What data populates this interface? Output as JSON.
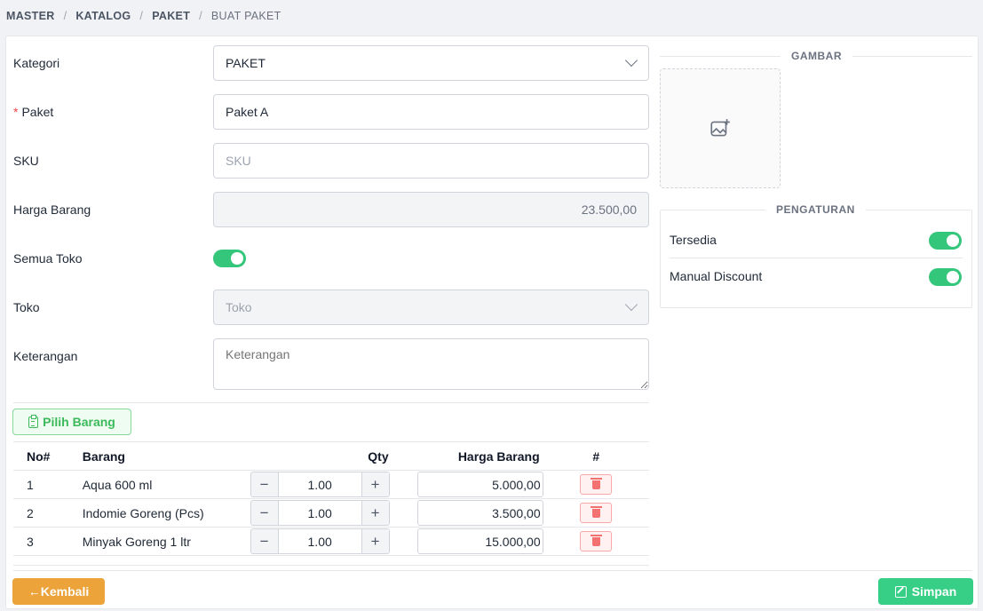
{
  "breadcrumb": [
    "MASTER",
    "KATALOG",
    "PAKET",
    "BUAT PAKET"
  ],
  "form": {
    "kategori": {
      "label": "Kategori",
      "value": "PAKET"
    },
    "paket": {
      "label": "Paket",
      "required_mark": "*",
      "value": "Paket A"
    },
    "sku": {
      "label": "SKU",
      "placeholder": "SKU"
    },
    "harga_barang": {
      "label": "Harga Barang",
      "value": "23.500,00"
    },
    "semua_toko": {
      "label": "Semua Toko",
      "on": true
    },
    "toko": {
      "label": "Toko",
      "placeholder": "Toko"
    },
    "keterangan": {
      "label": "Keterangan",
      "placeholder": "Keterangan"
    }
  },
  "pilih_barang_label": "Pilih Barang",
  "table": {
    "headers": {
      "no": "No#",
      "barang": "Barang",
      "qty": "Qty",
      "harga": "Harga Barang",
      "action": "#"
    },
    "rows": [
      {
        "no": "1",
        "barang": "Aqua 600 ml",
        "qty": "1.00",
        "harga": "5.000,00"
      },
      {
        "no": "2",
        "barang": "Indomie Goreng (Pcs)",
        "qty": "1.00",
        "harga": "3.500,00"
      },
      {
        "no": "3",
        "barang": "Minyak Goreng 1 ltr",
        "qty": "1.00",
        "harga": "15.000,00"
      }
    ]
  },
  "gambar_title": "GAMBAR",
  "pengaturan": {
    "title": "PENGATURAN",
    "items": [
      {
        "label": "Tersedia",
        "on": true
      },
      {
        "label": "Manual Discount",
        "on": true
      }
    ]
  },
  "buttons": {
    "kembali": "Kembali",
    "kembali_arrow": "←",
    "simpan": "Simpan"
  },
  "colors": {
    "toggle_on": "#34c77b",
    "kembali": "#eba33a",
    "simpan": "#37cf86",
    "pilih": "#3cba5b",
    "delete": "#f47171"
  },
  "icons": {
    "upload": "image-add-icon",
    "chevron": "chevron-down-icon",
    "delete": "trash-icon",
    "pilih": "clipboard-icon",
    "simpan": "edit-icon"
  }
}
